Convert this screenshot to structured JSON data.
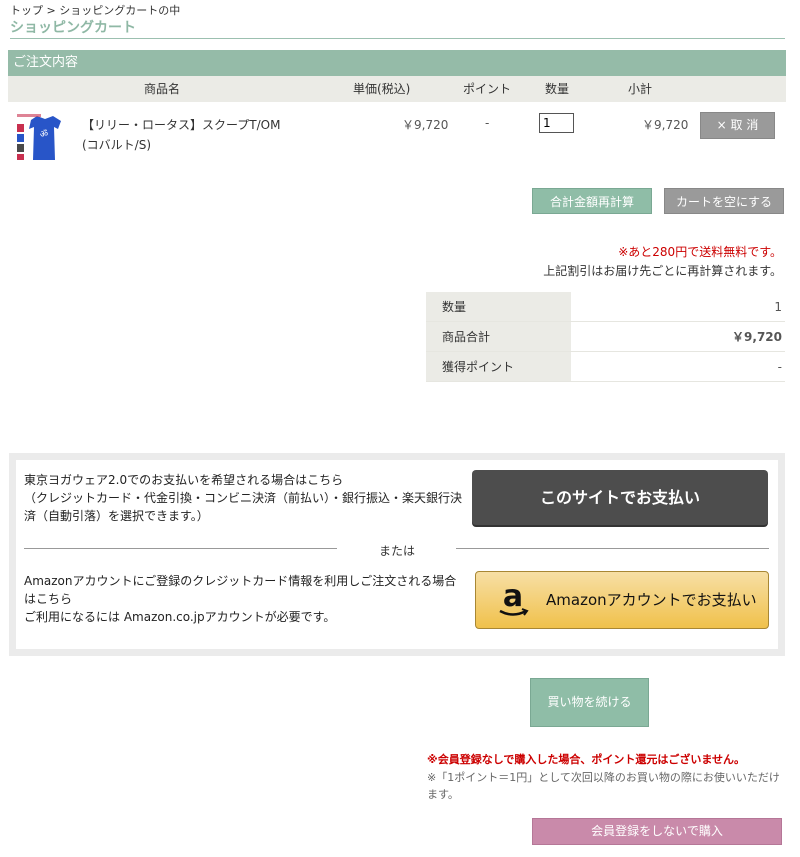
{
  "breadcrumb": "トップ > ショッピングカートの中",
  "page_title": "ショッピングカート",
  "section_title": "ご注文内容",
  "table_headers": {
    "product": "商品名",
    "unit_price": "単価(税込)",
    "point": "ポイント",
    "quantity": "数量",
    "subtotal": "小計"
  },
  "item": {
    "name_line1": "【リリー・ロータス】スクープT/OM",
    "name_line2": "(コバルト/S)",
    "price": "￥9,720",
    "point": "-",
    "quantity": "1",
    "subtotal": "￥9,720",
    "cancel_label": "× 取 消",
    "thumb_color": "#2855c8"
  },
  "buttons": {
    "recalc": "合計金額再計算",
    "empty_cart": "カートを空にする",
    "pay_site": "このサイトでお支払い",
    "pay_amazon": "Amazonアカウントでお支払い",
    "continue": "買い物を続ける",
    "guest_purchase": "会員登録をしないで購入"
  },
  "notes": {
    "shipping": "※あと280円で送料無料です。",
    "recalc": "上記割引はお届け先ごとに再計算されます。"
  },
  "summary": [
    {
      "label": "数量",
      "value": "1"
    },
    {
      "label": "商品合計",
      "value": "￥9,720"
    },
    {
      "label": "獲得ポイント",
      "value": "-"
    }
  ],
  "payment": {
    "site_line1": "東京ヨガウェア2.0でのお支払いを希望される場合はこちら",
    "site_line2": "（クレジットカード・代金引換・コンビニ決済（前払い）・銀行振込・楽天銀行決済（自動引落）を選択できます。）",
    "or": "または",
    "amazon_line1": "Amazonアカウントにご登録のクレジットカード情報を利用しご注文される場合はこちら",
    "amazon_line2": "ご利用になるには Amazon.co.jpアカウントが必要です。"
  },
  "warnings": {
    "red": "※会員登録なしで購入した場合、ポイント還元はございません。",
    "gray": "※「1ポイント＝1円」として次回以降のお買い物の際にお使いいただけます。"
  },
  "colors": {
    "accent_green": "#95bba8",
    "warning_red": "#cc0000",
    "guest_pink": "#c98aaa",
    "amazon_gold": "#f0c14b"
  }
}
